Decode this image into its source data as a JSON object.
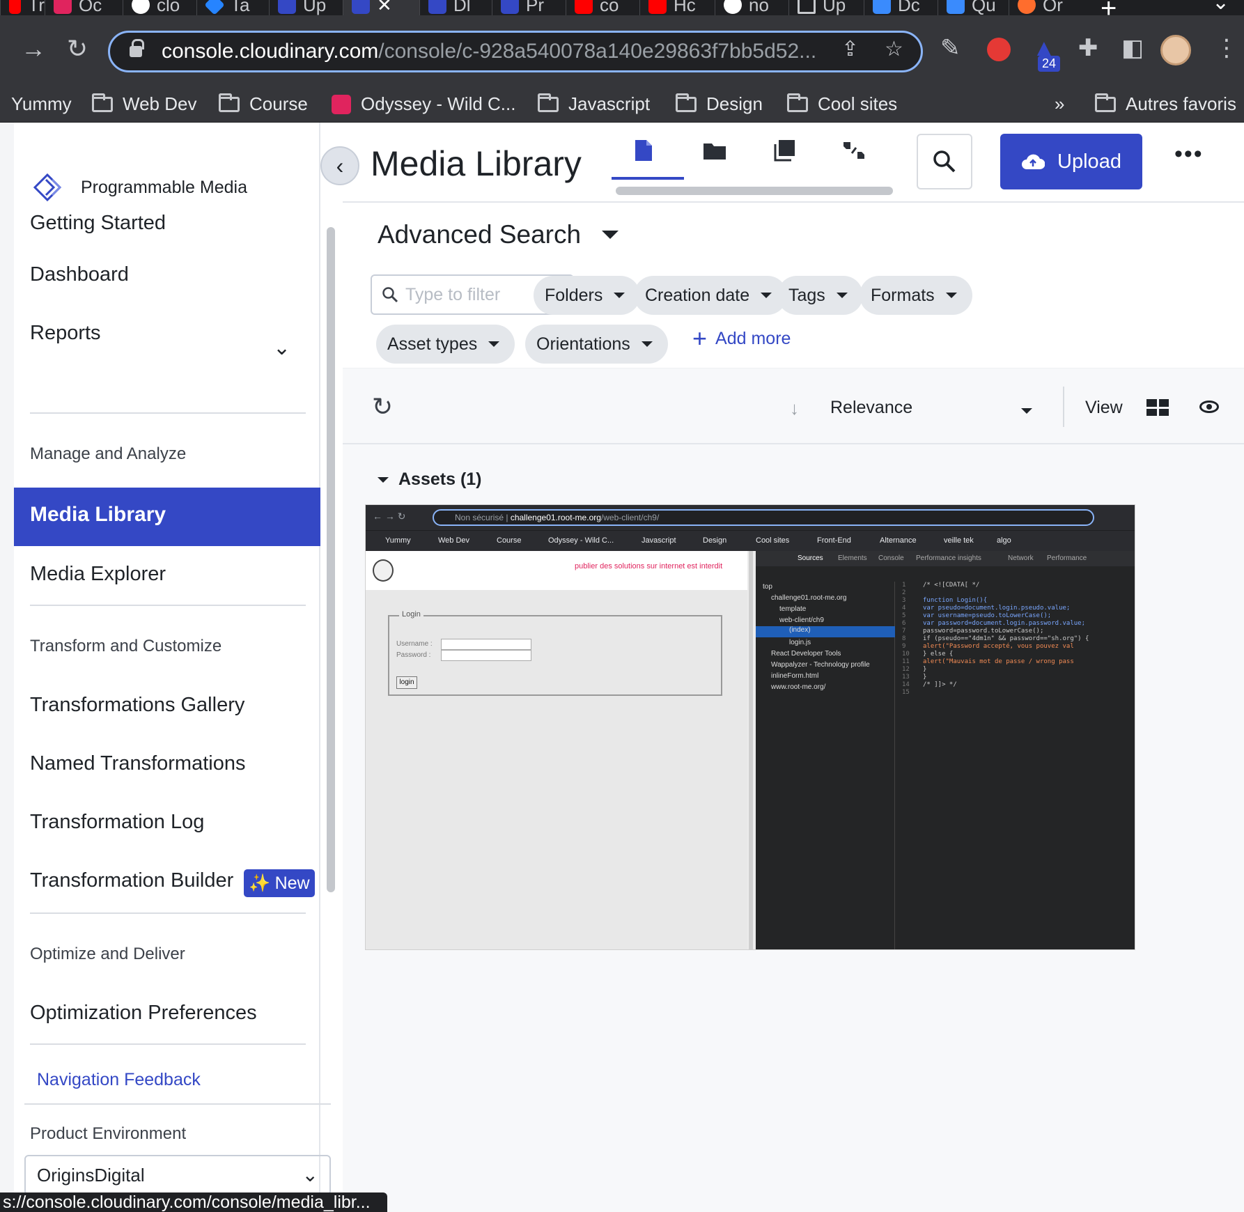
{
  "browser": {
    "tabs": [
      {
        "label": "Tr",
        "icon": "youtube-icon"
      },
      {
        "label": "Oc",
        "icon": "odyssey-icon"
      },
      {
        "label": "clo",
        "icon": "google-icon"
      },
      {
        "label": "Ta",
        "icon": "jira-icon"
      },
      {
        "label": "Up",
        "icon": "cloudinary-icon"
      },
      {
        "label": "",
        "icon": "cloudinary-icon"
      },
      {
        "label": "Dl",
        "icon": "cloudinary-icon"
      },
      {
        "label": "Pr",
        "icon": "cloudinary-icon"
      },
      {
        "label": "co",
        "icon": "youtube-icon"
      },
      {
        "label": "Hc",
        "icon": "youtube-icon"
      },
      {
        "label": "no",
        "icon": "google-icon"
      },
      {
        "label": "Up",
        "icon": "file-icon"
      },
      {
        "label": "Dc",
        "icon": "blue-icon"
      },
      {
        "label": "Qu",
        "icon": "blue-icon"
      },
      {
        "label": "Or",
        "icon": "orange-icon"
      }
    ],
    "active_tab_close": "✕",
    "url_host": "console.cloudinary.com",
    "url_path": "/console/c-928a540078a140e29863f7bb5d52...",
    "extension_badge": "24",
    "bookmarks": [
      {
        "label": "Yummy",
        "icon": "none"
      },
      {
        "label": "Web Dev",
        "icon": "folder-icon"
      },
      {
        "label": "Course",
        "icon": "folder-icon"
      },
      {
        "label": "Odyssey - Wild C...",
        "icon": "odyssey-icon"
      },
      {
        "label": "Javascript",
        "icon": "folder-icon"
      },
      {
        "label": "Design",
        "icon": "folder-icon"
      },
      {
        "label": "Cool sites",
        "icon": "folder-icon"
      }
    ],
    "bookmarks_overflow": "»",
    "other_bookmarks": "Autres favoris",
    "status_url": "s://console.cloudinary.com/console/media_libr..."
  },
  "sidebar": {
    "brand": "Programmable Media",
    "items": {
      "getting_started": "Getting Started",
      "dashboard": "Dashboard",
      "reports": "Reports",
      "media_library": "Media Library",
      "media_explorer": "Media Explorer",
      "transformations_gallery": "Transformations Gallery",
      "named_transformations": "Named Transformations",
      "transformation_log": "Transformation Log",
      "transformation_builder": "Transformation Builder",
      "optimization_preferences": "Optimization Preferences"
    },
    "sections": {
      "manage": "Manage and Analyze",
      "transform": "Transform and Customize",
      "optimize": "Optimize and Deliver"
    },
    "new_badge": "New",
    "new_badge_sparkle": "✨",
    "nav_feedback": "Navigation Feedback",
    "environment_label": "Product Environment",
    "environment_value": "OriginsDigital"
  },
  "main": {
    "title": "Media Library",
    "upload_label": "Upload",
    "more_label": "•••",
    "advanced_search": "Advanced Search",
    "filter_placeholder": "Type to filter",
    "chips": {
      "folders": "Folders",
      "creation_date": "Creation date",
      "tags": "Tags",
      "formats": "Formats",
      "asset_types": "Asset types",
      "orientations": "Orientations"
    },
    "add_more": "Add more",
    "sort_label": "Relevance",
    "view_label": "View",
    "assets_heading": "Assets (1)"
  },
  "asset_thumbnail": {
    "url_host": "challenge01.root-me.org",
    "url_path": "/web-client/ch9/",
    "url_prefix": "Non sécurisé",
    "bookmarks": [
      "Yummy",
      "Web Dev",
      "Course",
      "Odyssey - Wild C...",
      "Javascript",
      "Design",
      "Cool sites",
      "Front-End",
      "Alternance",
      "veille tek",
      "algo"
    ],
    "banner": "publier des solutions sur internet est interdit",
    "login_legend": "Login",
    "username_label": "Username :",
    "password_label": "Password :",
    "login_button": "login",
    "devtools_tabs": [
      "Sources",
      "Elements",
      "Console",
      "Performance insights",
      "Network",
      "Performance"
    ],
    "tree": [
      "top",
      "challenge01.root-me.org",
      "template",
      "web-client/ch9",
      "(index)",
      "login.js",
      "React Developer Tools",
      "Wappalyzer - Technology profile",
      "inlineForm.html",
      "www.root-me.org/"
    ],
    "code": [
      "/* <![CDATA[ */",
      "function Login(){",
      "  var pseudo=document.login.pseudo.value;",
      "  var username=pseudo.toLowerCase();",
      "  var password=document.login.password.value;",
      "  password=password.toLowerCase();",
      "  if (pseudo==\"4dm1n\" && password==\"sh.org\") {",
      "    alert(\"Password accepté, vous pouvez val",
      "  } else {",
      "    alert(\"Mauvais mot de passe / wrong pass",
      "  }",
      "}",
      "/* ]]> */"
    ]
  },
  "colors": {
    "accent": "#3448c5",
    "sidebar_active_text": "#ffffff",
    "browser_dark": "#35363a"
  }
}
